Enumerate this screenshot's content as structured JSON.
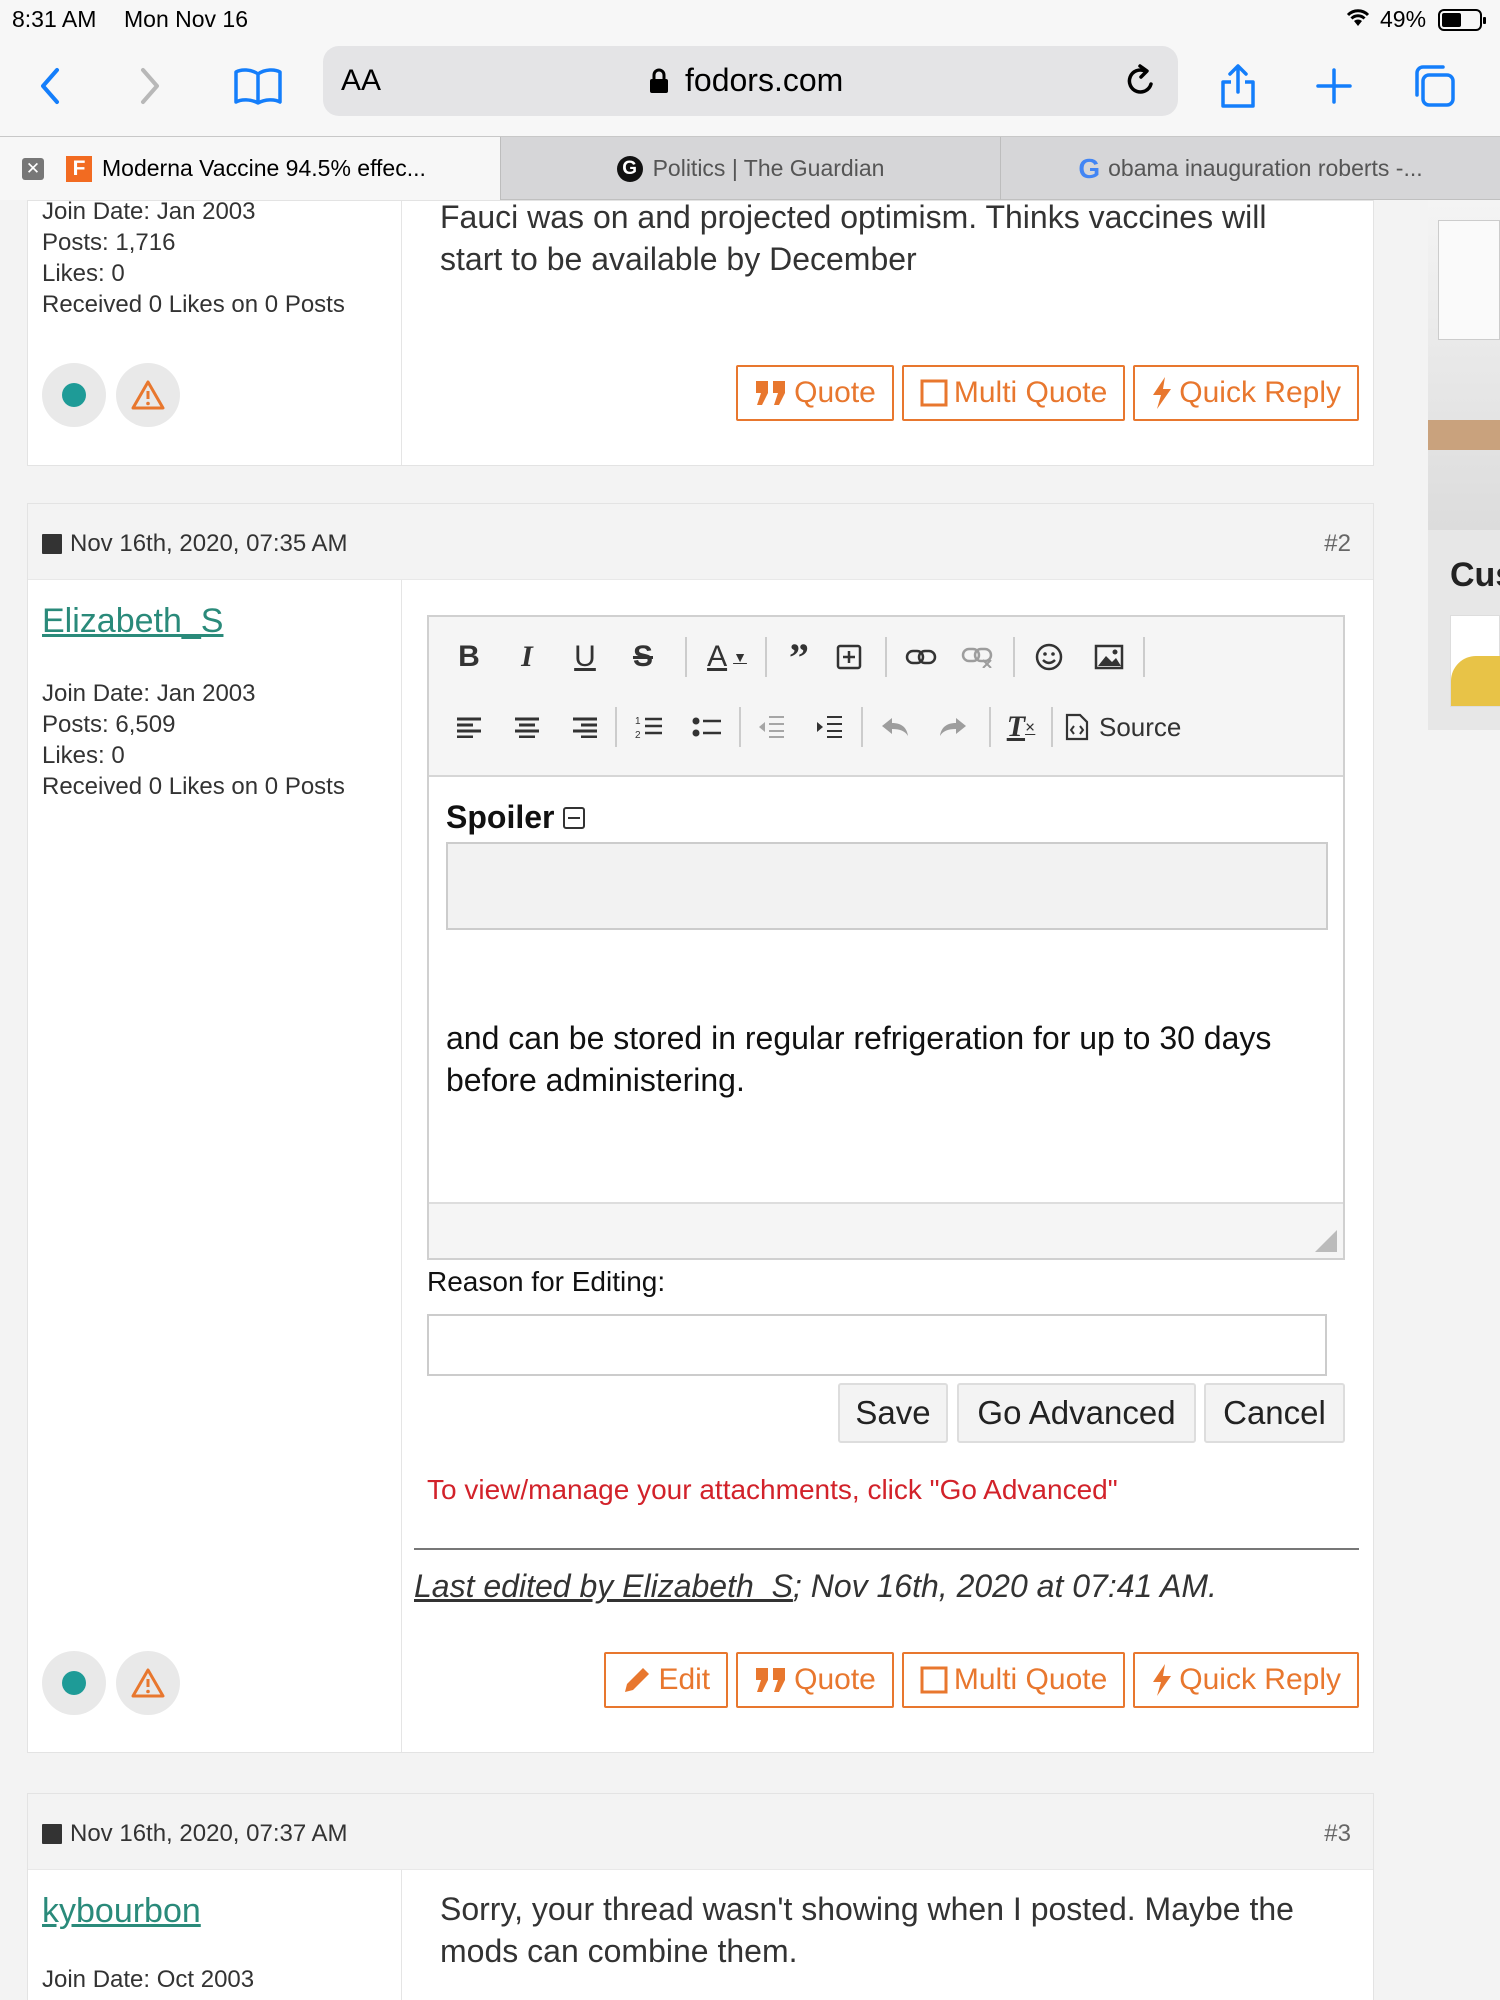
{
  "status": {
    "time": "8:31 AM",
    "date": "Mon Nov 16",
    "battery": "49%",
    "battery_level": 0.49
  },
  "browser": {
    "aa_label": "AA",
    "url": "fodors.com",
    "tabs": [
      {
        "title": "Moderna Vaccine 94.5% effec...",
        "active": true
      },
      {
        "title": "Politics | The Guardian",
        "active": false
      },
      {
        "title": "obama inauguration roberts -...",
        "active": false
      }
    ]
  },
  "labels": {
    "join_prefix": "Join Date: ",
    "posts_prefix": "Posts: ",
    "likes_prefix": "Likes: ",
    "quote": "Quote",
    "multi_quote": "Multi Quote",
    "quick_reply": "Quick Reply",
    "edit": "Edit"
  },
  "post1": {
    "join": "Join Date: Jan 2003",
    "posts": "Posts: 1,716",
    "likes": "Likes: 0",
    "received": "Received 0 Likes on 0 Posts",
    "text_line1": "Fauci was on and projected optimism. Thinks vaccines will",
    "text_line2": "start to be available by December"
  },
  "post2": {
    "date": "Nov 16th, 2020, 07:35 AM",
    "number_prefix": "#",
    "number": "2",
    "username": "Elizabeth_S",
    "join": "Join Date: Jan 2003",
    "posts": "Posts: 6,509",
    "likes": "Likes: 0",
    "received": "Received 0 Likes on 0 Posts",
    "editor": {
      "source_label": "Source",
      "spoiler_label": "Spoiler",
      "text_line1": "and can be stored in regular refrigeration for up to 30 days",
      "text_line2": "before administering."
    },
    "reason_label": "Reason for Editing:",
    "reason_value": "",
    "save_label": "Save",
    "go_advanced_label": "Go Advanced",
    "cancel_label": "Cancel",
    "attach_notice": "To view/manage your attachments, click \"Go Advanced\"",
    "last_edited_prefix": "Last edited by Elizabeth_S",
    "last_edited_suffix": "; Nov 16th, 2020 at 07:41 AM."
  },
  "post3": {
    "date": "Nov 16th, 2020, 07:37 AM",
    "number_prefix": "#",
    "number": "3",
    "username": "kybourbon",
    "join": "Join Date: Oct 2003",
    "text_line1": "Sorry, your thread wasn't showing when I posted. Maybe the",
    "text_line2": "mods can combine them."
  },
  "ad": {
    "heading": "Cus"
  },
  "colors": {
    "accent": "#e8772e",
    "username": "#2a8a7a",
    "notice": "#d2222a",
    "ios_blue": "#147efb"
  },
  "icons": [
    "wifi-icon",
    "battery-icon",
    "back-icon",
    "forward-icon",
    "bookmarks-icon",
    "lock-icon",
    "reload-icon",
    "share-icon",
    "new-tab-icon",
    "tabs-icon",
    "close-tab-icon",
    "quote-icon",
    "checkbox-icon",
    "bolt-icon",
    "pencil-icon",
    "warning-icon",
    "online-dot-icon"
  ]
}
